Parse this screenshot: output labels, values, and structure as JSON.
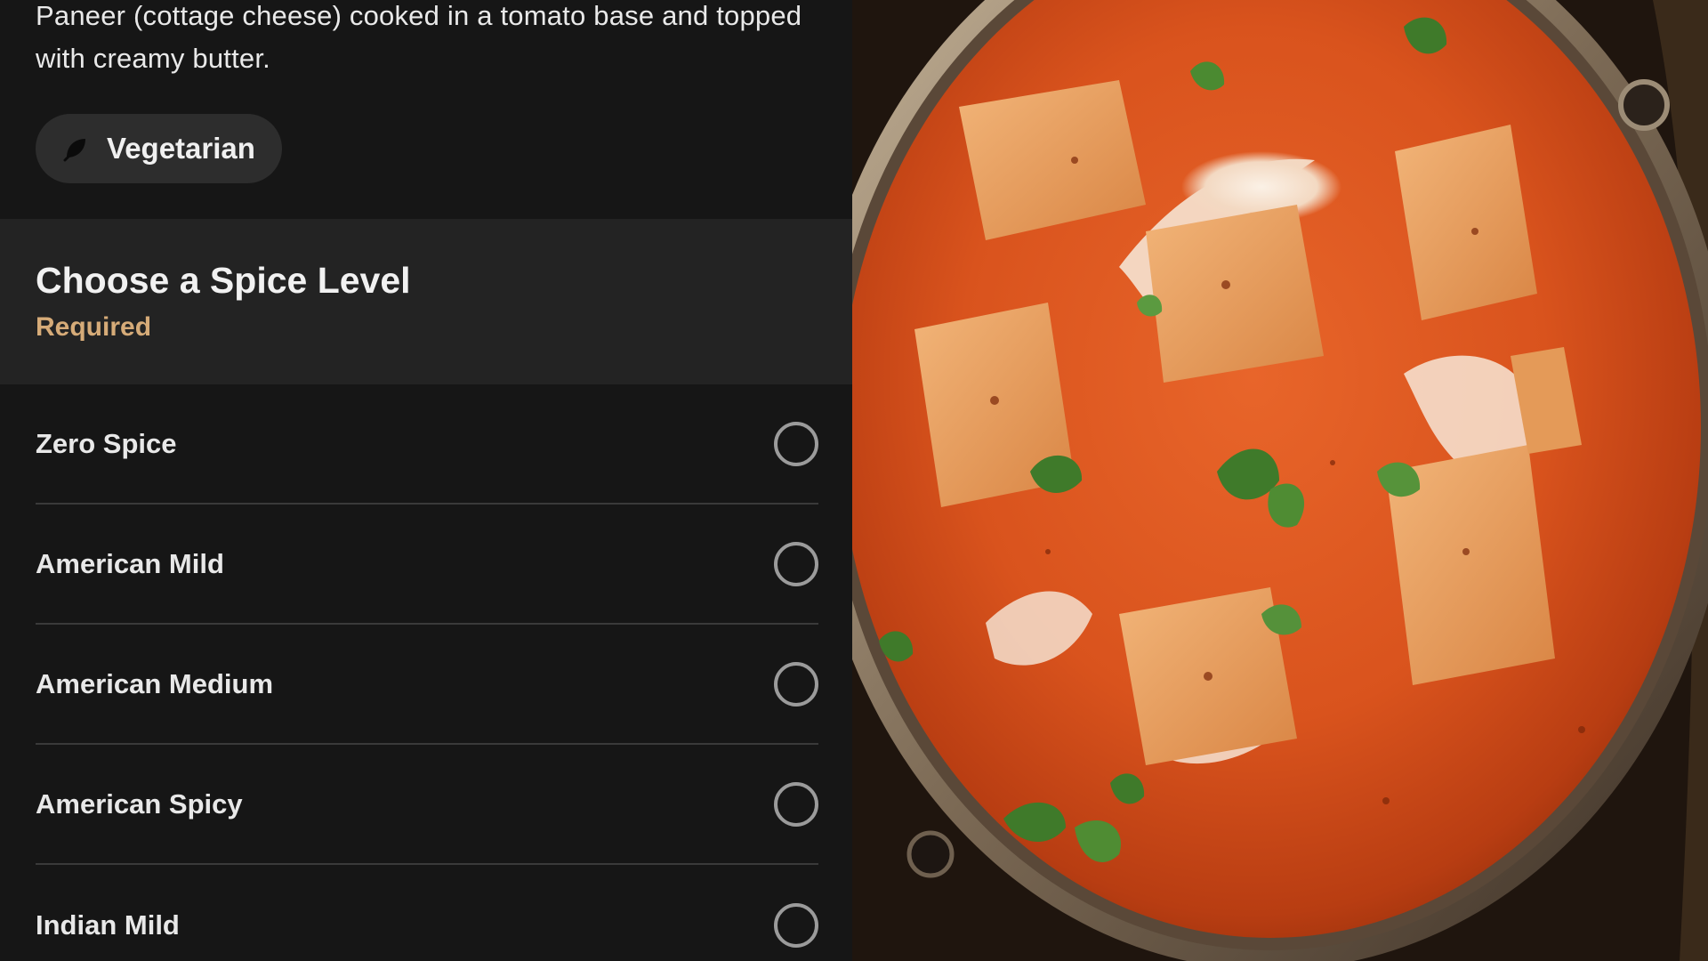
{
  "item": {
    "description": "Paneer (cottage cheese) cooked in a tomato base and topped with creamy butter.",
    "diet_tag": {
      "label": "Vegetarian",
      "icon": "leaf-icon"
    }
  },
  "spice_section": {
    "title": "Choose a Spice Level",
    "required_label": "Required",
    "options": [
      {
        "label": "Zero Spice"
      },
      {
        "label": "American Mild"
      },
      {
        "label": "American Medium"
      },
      {
        "label": "American Spicy"
      },
      {
        "label": "Indian Mild"
      }
    ]
  },
  "colors": {
    "panel_background": "#161616",
    "section_header_background": "#232323",
    "required_accent": "#d6ab78",
    "radio_outline": "#9b9b9b"
  },
  "photo": {
    "subject": "paneer butter masala in a metal kadai"
  }
}
